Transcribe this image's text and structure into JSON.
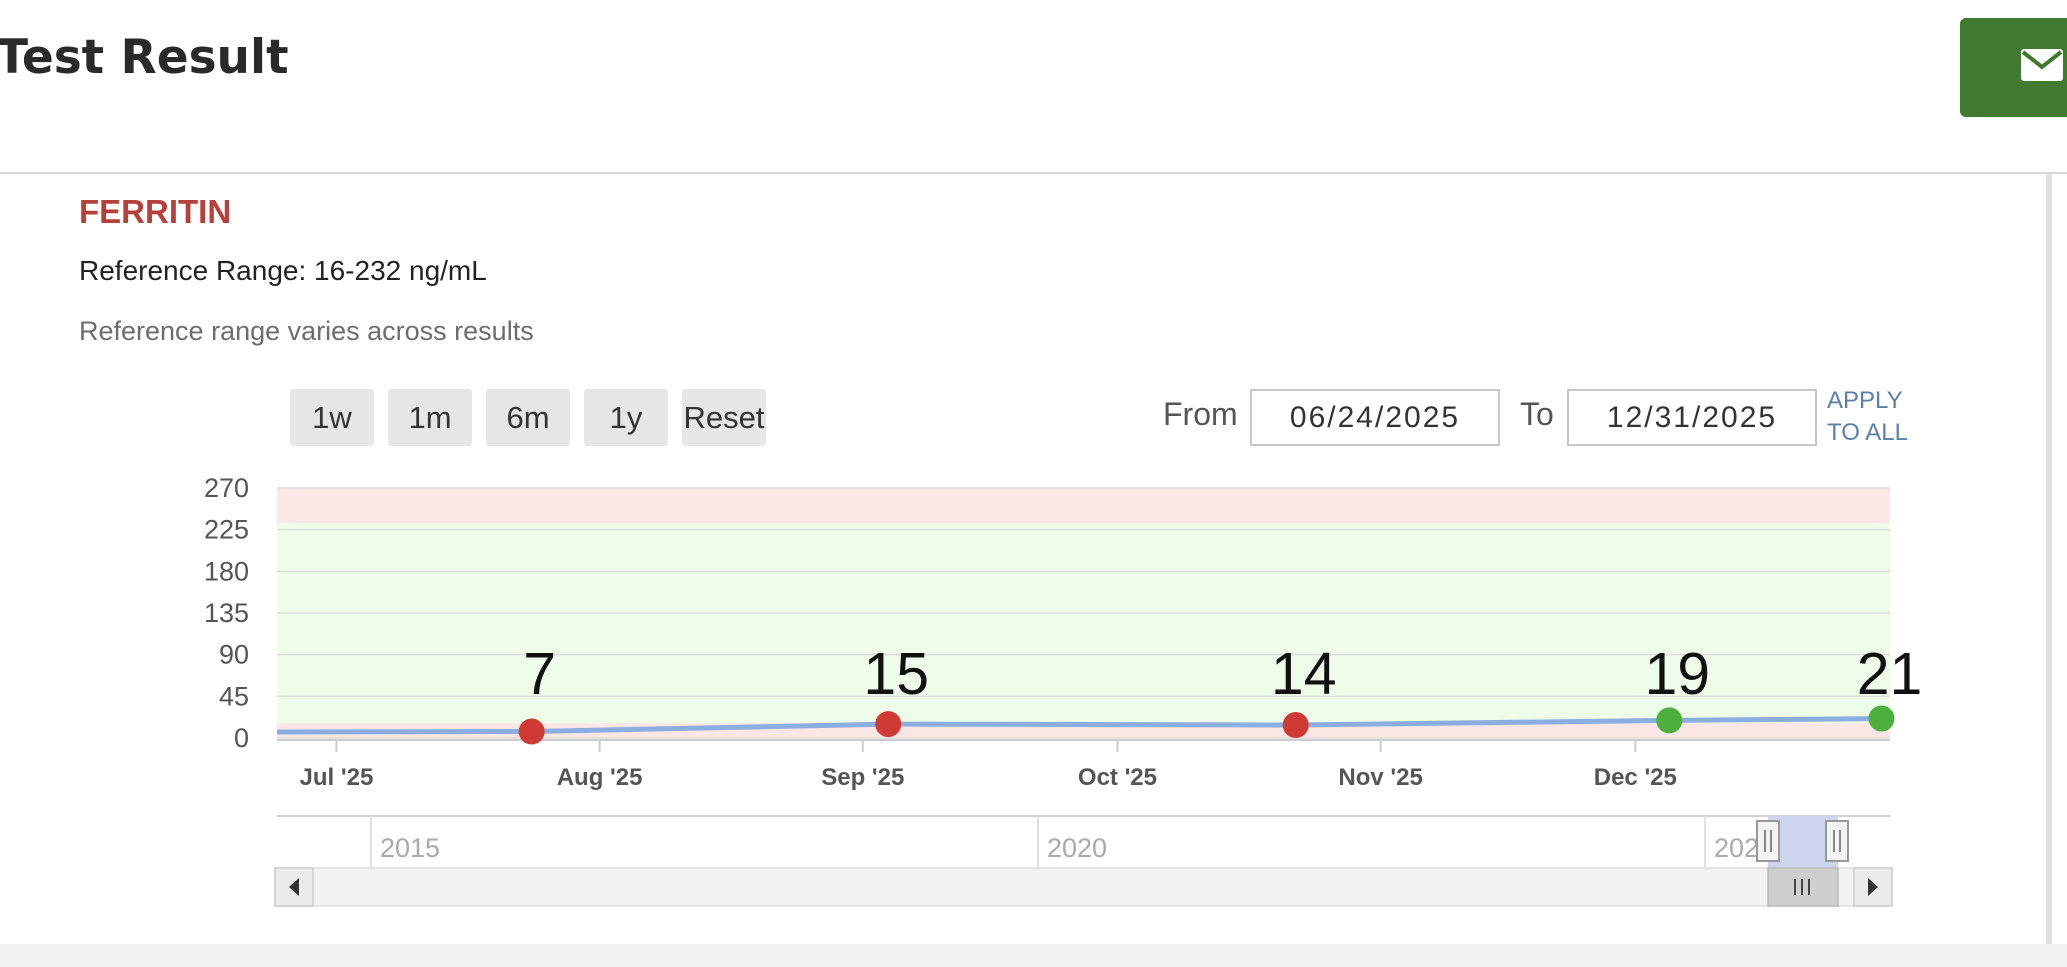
{
  "header": {
    "title": "Test Result",
    "email_icon": "envelope-icon",
    "accent_color": "#3f7a30"
  },
  "result": {
    "name": "FERRITIN",
    "name_color": "#b8403a",
    "reference_range": "Reference Range: 16-232 ng/mL",
    "reference_note": "Reference range varies across results"
  },
  "range_selector": {
    "buttons": [
      "1w",
      "1m",
      "6m",
      "1y",
      "Reset"
    ]
  },
  "date_filter": {
    "from_label": "From",
    "from_value": "06/24/2025",
    "to_label": "To",
    "to_value": "12/31/2025",
    "apply_label": "APPLY TO ALL"
  },
  "chart_data": {
    "type": "line",
    "y_ticks": [
      "0",
      "45",
      "90",
      "135",
      "180",
      "225",
      "270"
    ],
    "ylim": [
      0,
      270
    ],
    "x_ticks": [
      {
        "label": "Jul '25",
        "date": "2025-07-01"
      },
      {
        "label": "Aug '25",
        "date": "2025-08-01"
      },
      {
        "label": "Sep '25",
        "date": "2025-09-01"
      },
      {
        "label": "Oct '25",
        "date": "2025-10-01"
      },
      {
        "label": "Nov '25",
        "date": "2025-11-01"
      },
      {
        "label": "Dec '25",
        "date": "2025-12-01"
      }
    ],
    "xlim": [
      "2025-06-24",
      "2025-12-31"
    ],
    "series": [
      {
        "line_color": "#8aaee0",
        "points": [
          {
            "date": "2025-07-24",
            "value": 7,
            "label": "7",
            "status": "abnormal"
          },
          {
            "date": "2025-09-04",
            "value": 15,
            "label": "15",
            "status": "abnormal"
          },
          {
            "date": "2025-10-22",
            "value": 14,
            "label": "14",
            "status": "abnormal"
          },
          {
            "date": "2025-12-05",
            "value": 19,
            "label": "19",
            "status": "normal"
          },
          {
            "date": "2025-12-30",
            "value": 21,
            "label": "21",
            "status": "normal"
          }
        ]
      }
    ],
    "bands": [
      {
        "from": 232,
        "to": 270,
        "color": "#fde6e6"
      },
      {
        "from": 16,
        "to": 232,
        "color": "#eefde8"
      }
    ],
    "status_colors": {
      "abnormal": "#d03a35",
      "normal": "#4caf3e"
    },
    "grid": true,
    "legend": "none"
  },
  "navigator": {
    "year_labels": [
      "2015",
      "2020",
      "202"
    ]
  }
}
